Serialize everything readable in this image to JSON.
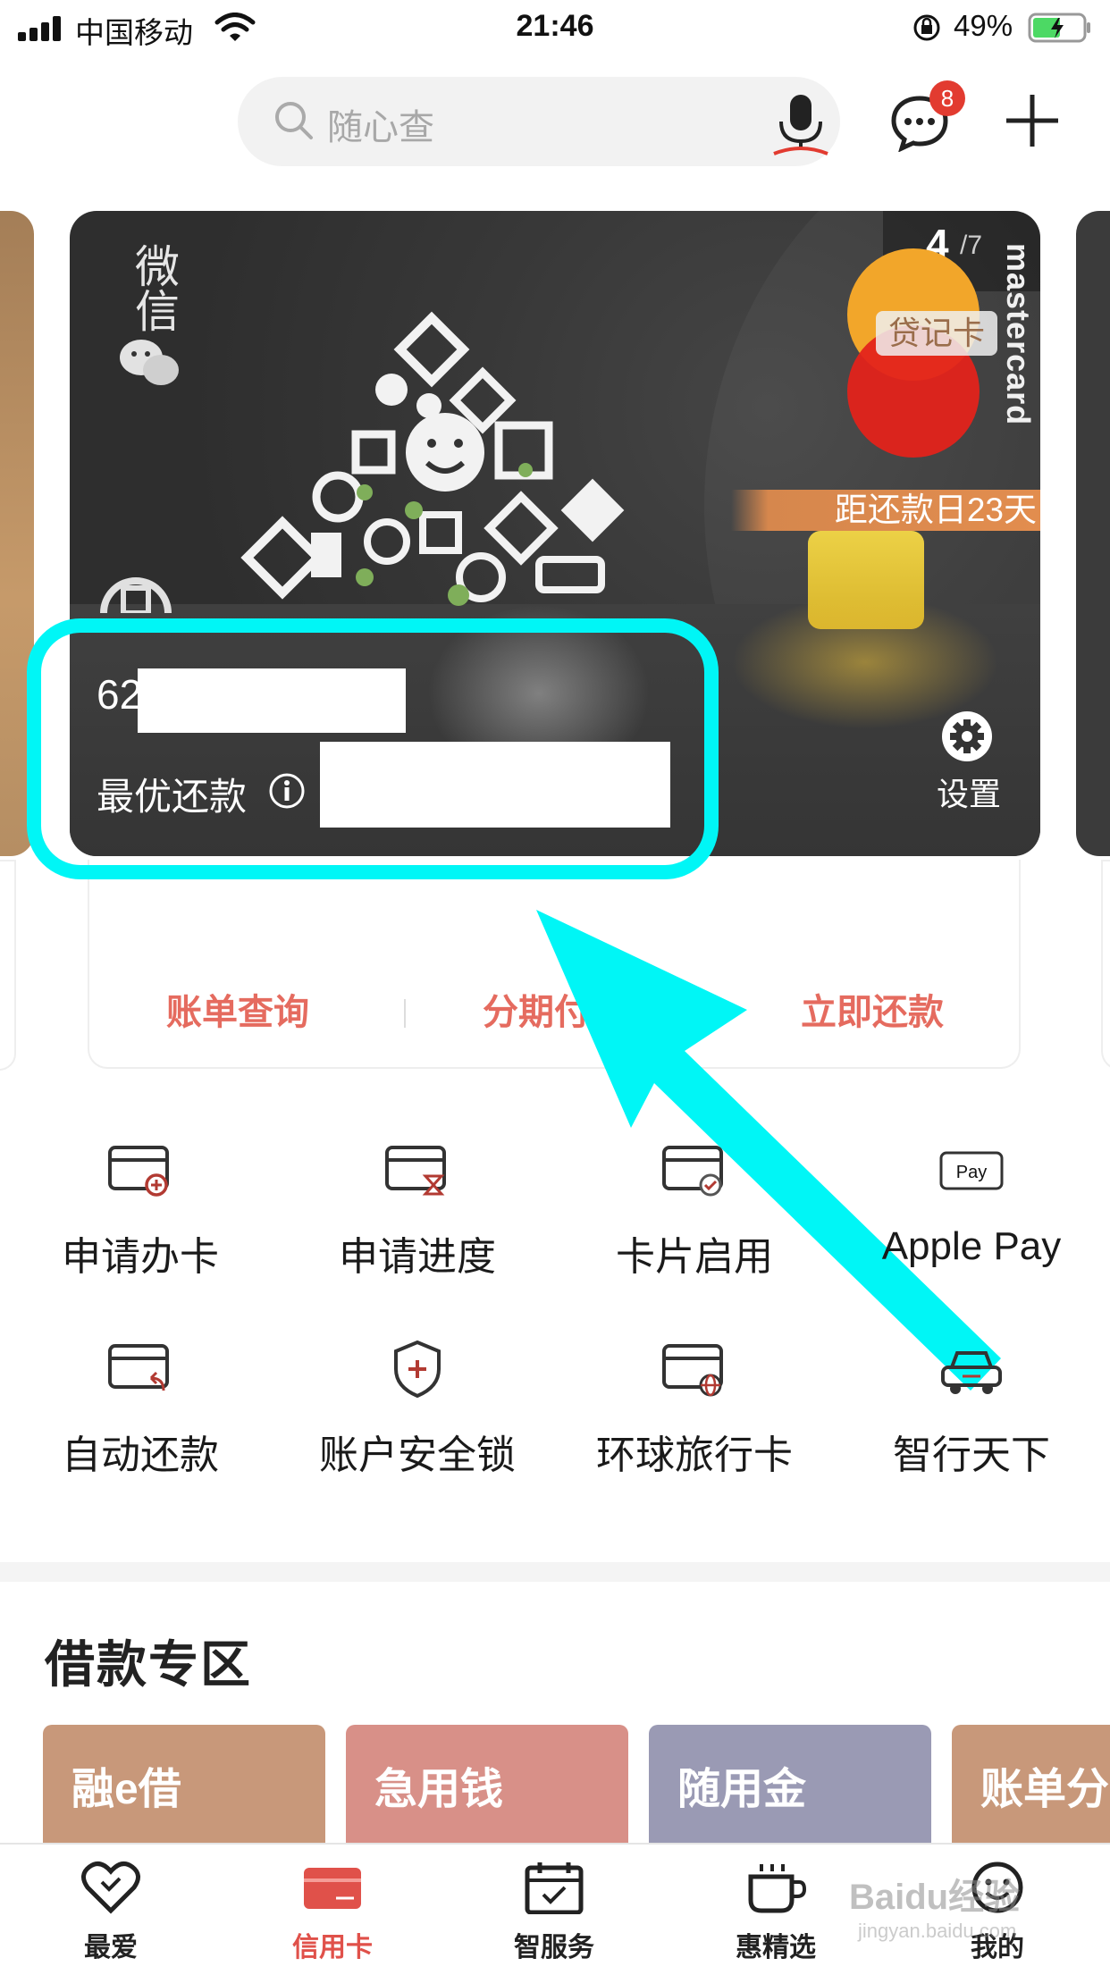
{
  "status_bar": {
    "carrier": "中国移动",
    "time": "21:46",
    "battery_percent": "49%"
  },
  "search": {
    "placeholder": "随心查",
    "message_badge": "8"
  },
  "card": {
    "brand_vertical": "微信",
    "page_current": "4",
    "page_total": "/7",
    "network": "mastercard",
    "card_type": "贷记卡",
    "due_notice": "距还款日23天",
    "number_prefix": "62",
    "best_repay_label": "最优还款",
    "settings_label": "设置"
  },
  "card_actions": [
    "账单查询",
    "分期付",
    "立即还款"
  ],
  "services": [
    {
      "label": "申请办卡",
      "icon": "card-add-icon"
    },
    {
      "label": "申请进度",
      "icon": "card-hourglass-icon"
    },
    {
      "label": "卡片启用",
      "icon": "card-check-icon"
    },
    {
      "label": "Apple Pay",
      "icon": "apple-pay-icon"
    },
    {
      "label": "自动还款",
      "icon": "card-auto-return-icon"
    },
    {
      "label": "账户安全锁",
      "icon": "shield-plus-icon"
    },
    {
      "label": "环球旅行卡",
      "icon": "card-globe-icon"
    },
    {
      "label": "智行天下",
      "icon": "car-icon"
    }
  ],
  "loan_section": {
    "title": "借款专区",
    "items": [
      {
        "label": "融e借",
        "color": "#c8987a"
      },
      {
        "label": "急用钱",
        "color": "#d89088"
      },
      {
        "label": "随用金",
        "color": "#9a9ab4"
      },
      {
        "label": "账单分",
        "color": "#c8987a"
      }
    ]
  },
  "tabs": [
    {
      "label": "最爱",
      "icon": "heart-icon"
    },
    {
      "label": "信用卡",
      "icon": "credit-card-icon",
      "active": true
    },
    {
      "label": "智服务",
      "icon": "calendar-check-icon"
    },
    {
      "label": "惠精选",
      "icon": "cup-icon"
    },
    {
      "label": "我的",
      "icon": "smiley-icon"
    }
  ],
  "watermark": {
    "text": "Baidu经验",
    "sub": "jingyan.baidu.com"
  },
  "colors": {
    "accent": "#e0514a",
    "highlight": "#00f6f6",
    "card_bg": "#333333"
  }
}
